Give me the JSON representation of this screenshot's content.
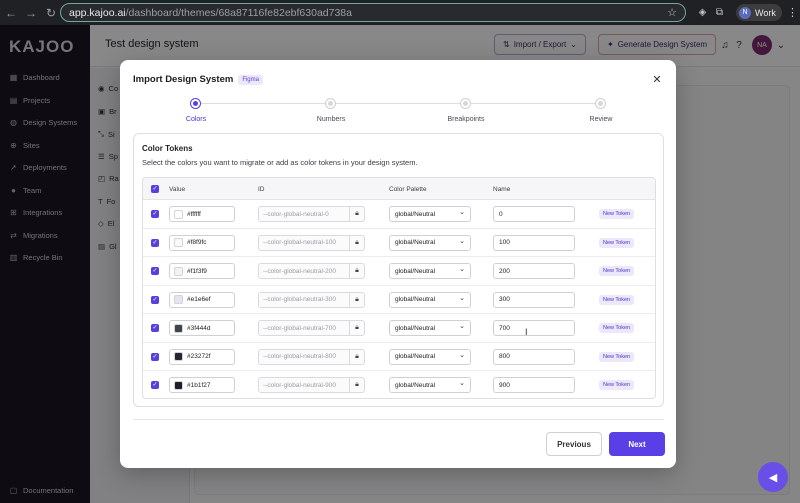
{
  "browser": {
    "url_domain": "app.kajoo.ai",
    "url_path": "/dashboard/themes/68a87116fe82ebf630ad738a",
    "profile_initial": "N",
    "profile_label": "Work"
  },
  "sidebar": {
    "logo": "KAJOO",
    "items": [
      {
        "label": "Dashboard",
        "icon": "dashboard-icon"
      },
      {
        "label": "Projects",
        "icon": "projects-icon"
      },
      {
        "label": "Design Systems",
        "icon": "palette-icon"
      },
      {
        "label": "Sites",
        "icon": "globe-icon"
      },
      {
        "label": "Deployments",
        "icon": "rocket-icon"
      },
      {
        "label": "Team",
        "icon": "team-icon"
      },
      {
        "label": "Integrations",
        "icon": "plug-icon"
      },
      {
        "label": "Migrations",
        "icon": "migrate-icon"
      },
      {
        "label": "Recycle Bin",
        "icon": "trash-icon"
      }
    ],
    "footer": "Documentation"
  },
  "header": {
    "title": "Test design system",
    "import_export_label": "Import / Export",
    "generate_label": "Generate Design System",
    "user_initials": "NA"
  },
  "subnav": {
    "items": [
      "Co",
      "Br",
      "Si",
      "Sp",
      "Ra",
      "Fo",
      "El",
      "Gl"
    ]
  },
  "modal": {
    "title": "Import Design System",
    "badge": "Figma",
    "steps": [
      {
        "label": "Colors",
        "active": true
      },
      {
        "label": "Numbers",
        "active": false
      },
      {
        "label": "Breakpoints",
        "active": false
      },
      {
        "label": "Review",
        "active": false
      }
    ],
    "panel_title": "Color Tokens",
    "panel_desc": "Select the colors you want to migrate or add as color tokens in your design system.",
    "columns": {
      "value": "Value",
      "id": "ID",
      "palette": "Color Palette",
      "name": "Name"
    },
    "rows": [
      {
        "value": "#ffffff",
        "swatch": "#ffffff",
        "id": "--color-global-neutral-0",
        "palette": "global/Neutral",
        "name": "0",
        "badge": "New Token"
      },
      {
        "value": "#f8f9fc",
        "swatch": "#f8f9fc",
        "id": "--color-global-neutral-100",
        "palette": "global/Neutral",
        "name": "100",
        "badge": "New Token"
      },
      {
        "value": "#f1f3f9",
        "swatch": "#f1f3f9",
        "id": "--color-global-neutral-200",
        "palette": "global/Neutral",
        "name": "200",
        "badge": "New Token"
      },
      {
        "value": "#e1e6ef",
        "swatch": "#e1e6ef",
        "id": "--color-global-neutral-300",
        "palette": "global/Neutral",
        "name": "300",
        "badge": "New Token"
      },
      {
        "value": "#3f444d",
        "swatch": "#3f444d",
        "id": "--color-global-neutral-700",
        "palette": "global/Neutral",
        "name": "700",
        "badge": "New Token"
      },
      {
        "value": "#23272f",
        "swatch": "#23272f",
        "id": "--color-global-neutral-800",
        "palette": "global/Neutral",
        "name": "800",
        "badge": "New Token"
      },
      {
        "value": "#1b1f27",
        "swatch": "#1b1f27",
        "id": "--color-global-neutral-900",
        "palette": "global/Neutral",
        "name": "900",
        "badge": "New Token"
      }
    ],
    "previous_label": "Previous",
    "next_label": "Next"
  }
}
